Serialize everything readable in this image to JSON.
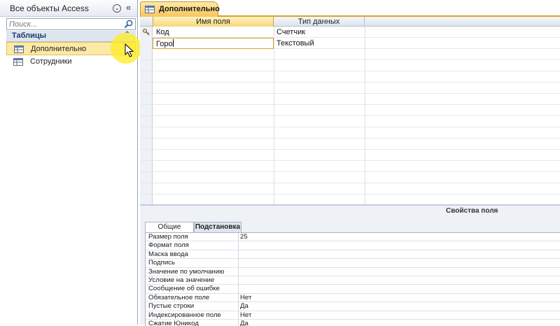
{
  "nav": {
    "title": "Все объекты Access",
    "dropdown_glyph": "⌄",
    "collapse_glyph": "«",
    "search_placeholder": "Поиск...",
    "group_title": "Таблицы",
    "group_toggle_glyph": "⌃",
    "items": [
      {
        "label": "Дополнительно",
        "selected": true
      },
      {
        "label": "Сотрудники",
        "selected": false
      }
    ]
  },
  "document": {
    "tab_label": "Дополнительно"
  },
  "grid": {
    "headers": {
      "name": "Имя поля",
      "type": "Тип данных"
    },
    "rows": [
      {
        "name": "Код",
        "type": "Счетчик",
        "primary_key": true
      },
      {
        "name": "Горо",
        "type": "Текстовый",
        "editing": true
      }
    ]
  },
  "properties": {
    "title": "Свойства поля",
    "tabs": [
      "Общие",
      "Подстановка"
    ],
    "active_tab": "Общие",
    "rows": [
      {
        "label": "Размер поля",
        "value": "25"
      },
      {
        "label": "Формат поля",
        "value": ""
      },
      {
        "label": "Маска ввода",
        "value": ""
      },
      {
        "label": "Подпись",
        "value": ""
      },
      {
        "label": "Значение по умолчанию",
        "value": ""
      },
      {
        "label": "Условие на значение",
        "value": ""
      },
      {
        "label": "Сообщение об ошибке",
        "value": ""
      },
      {
        "label": "Обязательное поле",
        "value": "Нет"
      },
      {
        "label": "Пустые строки",
        "value": "Да"
      },
      {
        "label": "Индексированное поле",
        "value": "Нет"
      },
      {
        "label": "Сжатие Юникод",
        "value": "Да"
      }
    ]
  },
  "colors": {
    "tab_accent": "#f7c65c",
    "cursor_highlight": "#ffec28",
    "nav_group_text": "#1b3b6f"
  }
}
